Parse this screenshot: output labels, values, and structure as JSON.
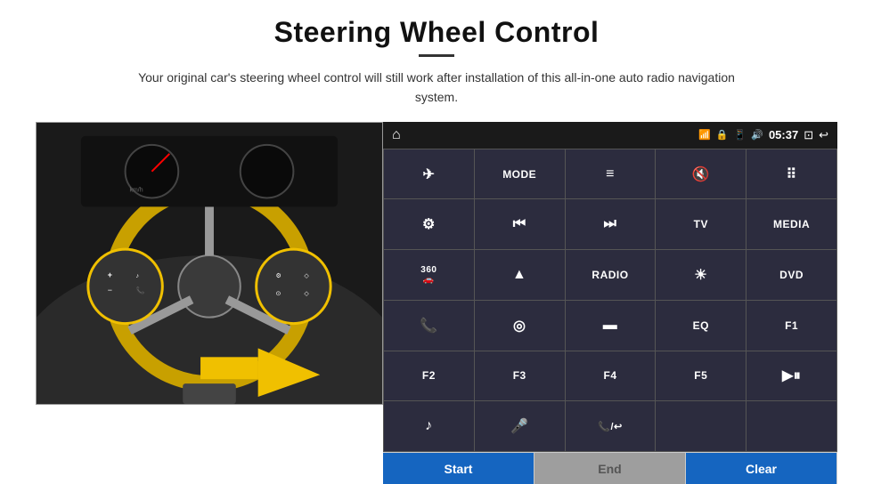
{
  "header": {
    "title": "Steering Wheel Control",
    "subtitle": "Your original car's steering wheel control will still work after installation of this all-in-one auto radio navigation system."
  },
  "status_bar": {
    "home_icon": "⌂",
    "wifi_icon": "📶",
    "lock_icon": "🔒",
    "sd_icon": "💾",
    "bt_icon": "🔊",
    "time": "05:37",
    "screen_icon": "⊡",
    "back_icon": "↩"
  },
  "buttons": [
    {
      "label": "✈",
      "type": "icon"
    },
    {
      "label": "MODE",
      "type": "text"
    },
    {
      "label": "≡",
      "type": "icon"
    },
    {
      "label": "🔇",
      "type": "icon"
    },
    {
      "label": "⠿",
      "type": "icon"
    },
    {
      "label": "⚙",
      "type": "icon"
    },
    {
      "label": "⏮",
      "type": "icon"
    },
    {
      "label": "⏭",
      "type": "icon"
    },
    {
      "label": "TV",
      "type": "text"
    },
    {
      "label": "MEDIA",
      "type": "text"
    },
    {
      "label": "360",
      "type": "text-small"
    },
    {
      "label": "▲",
      "type": "icon"
    },
    {
      "label": "RADIO",
      "type": "text"
    },
    {
      "label": "☀",
      "type": "icon"
    },
    {
      "label": "DVD",
      "type": "text"
    },
    {
      "label": "📞",
      "type": "icon"
    },
    {
      "label": "◎",
      "type": "icon"
    },
    {
      "label": "▬",
      "type": "icon"
    },
    {
      "label": "EQ",
      "type": "text"
    },
    {
      "label": "F1",
      "type": "text"
    },
    {
      "label": "F2",
      "type": "text"
    },
    {
      "label": "F3",
      "type": "text"
    },
    {
      "label": "F4",
      "type": "text"
    },
    {
      "label": "F5",
      "type": "text"
    },
    {
      "label": "▶⏸",
      "type": "icon"
    },
    {
      "label": "♪",
      "type": "icon"
    },
    {
      "label": "🎤",
      "type": "icon"
    },
    {
      "label": "📞/↩",
      "type": "icon"
    },
    {
      "label": "",
      "type": "empty"
    },
    {
      "label": "",
      "type": "empty"
    }
  ],
  "bottom_buttons": {
    "start": "Start",
    "end": "End",
    "clear": "Clear"
  }
}
